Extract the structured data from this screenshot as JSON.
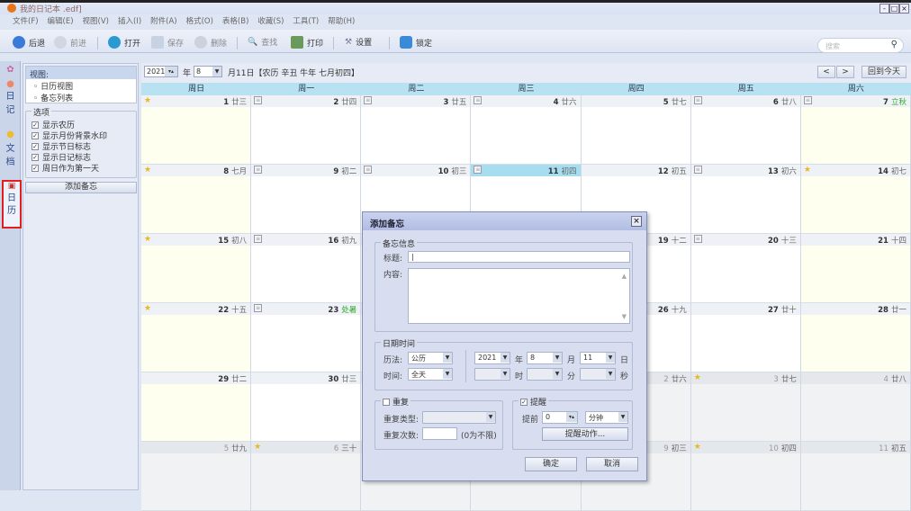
{
  "window": {
    "title": "我的日记本 .edf]",
    "min": "-",
    "max": "□",
    "close": "×"
  },
  "menu": [
    "文件(F)",
    "编辑(E)",
    "视图(V)",
    "插入(I)",
    "附件(A)",
    "格式(O)",
    "表格(B)",
    "收藏(S)",
    "工具(T)",
    "帮助(H)"
  ],
  "toolbar": {
    "back": "后退",
    "forward": "前进",
    "open": "打开",
    "save": "保存",
    "delete": "删除",
    "find": "查找",
    "print": "打印",
    "settings": "设置",
    "lock": "锁定"
  },
  "search": {
    "placeholder": "搜索"
  },
  "vtabs": {
    "diary": "日记",
    "docs": "文档",
    "calendar": "日历"
  },
  "panel": {
    "view_title": "视图:",
    "views": [
      "日历视图",
      "备忘列表"
    ],
    "options_title": "选项",
    "options": [
      "显示农历",
      "显示月份背景水印",
      "显示节日标志",
      "显示日记标志",
      "周日作为第一天"
    ],
    "add_memo": "添加备忘"
  },
  "datebar": {
    "year": "2021",
    "year_label": "年",
    "month": "8",
    "info": "月11日【农历 辛丑 牛年 七月初四】",
    "prev": "<",
    "next": ">",
    "today": "回到今天"
  },
  "weekdays": [
    "周日",
    "周一",
    "周二",
    "周三",
    "周四",
    "周五",
    "周六"
  ],
  "calendar": {
    "weeks": [
      [
        {
          "d": "1",
          "l": "廿三",
          "i": "star"
        },
        {
          "d": "2",
          "l": "廿四",
          "i": "note"
        },
        {
          "d": "3",
          "l": "廿五",
          "i": "note"
        },
        {
          "d": "4",
          "l": "廿六",
          "i": "note"
        },
        {
          "d": "5",
          "l": "廿七",
          "i": ""
        },
        {
          "d": "6",
          "l": "廿八",
          "i": "note"
        },
        {
          "d": "7",
          "l": "立秋",
          "i": "note",
          "t": 1
        }
      ],
      [
        {
          "d": "8",
          "l": "七月",
          "i": "star"
        },
        {
          "d": "9",
          "l": "初二",
          "i": "note"
        },
        {
          "d": "10",
          "l": "初三",
          "i": "note"
        },
        {
          "d": "11",
          "l": "初四",
          "i": "note",
          "today": 1
        },
        {
          "d": "12",
          "l": "初五",
          "i": ""
        },
        {
          "d": "13",
          "l": "初六",
          "i": "note"
        },
        {
          "d": "14",
          "l": "初七",
          "i": "star"
        }
      ],
      [
        {
          "d": "15",
          "l": "初八",
          "i": "star"
        },
        {
          "d": "16",
          "l": "初九",
          "i": "note"
        },
        {
          "d": "",
          "l": "",
          "i": ""
        },
        {
          "d": "",
          "l": "",
          "i": ""
        },
        {
          "d": "19",
          "l": "十二",
          "i": ""
        },
        {
          "d": "20",
          "l": "十三",
          "i": "note"
        },
        {
          "d": "21",
          "l": "十四",
          "i": ""
        }
      ],
      [
        {
          "d": "22",
          "l": "十五",
          "i": "star"
        },
        {
          "d": "23",
          "l": "处暑",
          "i": "note",
          "t": 1
        },
        {
          "d": "",
          "l": "",
          "i": ""
        },
        {
          "d": "",
          "l": "",
          "i": ""
        },
        {
          "d": "26",
          "l": "十九",
          "i": ""
        },
        {
          "d": "27",
          "l": "廿十",
          "i": ""
        },
        {
          "d": "28",
          "l": "廿一",
          "i": ""
        }
      ],
      [
        {
          "d": "29",
          "l": "廿二",
          "i": ""
        },
        {
          "d": "30",
          "l": "廿三",
          "i": ""
        },
        {
          "d": "",
          "l": "",
          "i": ""
        },
        {
          "d": "",
          "l": "",
          "i": "",
          "o": 1
        },
        {
          "d": "2",
          "l": "廿六",
          "i": "",
          "o": 1
        },
        {
          "d": "3",
          "l": "廿七",
          "i": "star",
          "o": 1
        },
        {
          "d": "4",
          "l": "廿八",
          "i": "",
          "o": 1
        }
      ],
      [
        {
          "d": "5",
          "l": "廿九",
          "i": "",
          "o": 1
        },
        {
          "d": "6",
          "l": "三十",
          "i": "star",
          "o": 1
        },
        {
          "d": "",
          "l": "",
          "i": "",
          "o": 1
        },
        {
          "d": "",
          "l": "",
          "i": "",
          "o": 1
        },
        {
          "d": "9",
          "l": "初三",
          "i": "",
          "o": 1
        },
        {
          "d": "10",
          "l": "初四",
          "i": "star",
          "o": 1
        },
        {
          "d": "11",
          "l": "初五",
          "i": "",
          "o": 1
        }
      ]
    ]
  },
  "dialog": {
    "title": "添加备忘",
    "close": "×",
    "info_group": "备忘信息",
    "title_label": "标题:",
    "title_value": "|",
    "content_label": "内容:",
    "datetime_group": "日期时间",
    "calendar_label": "历法:",
    "calendar_value": "公历",
    "time_label": "时间:",
    "time_value": "全天",
    "year": "2021",
    "year_label": "年",
    "month": "8",
    "month_label": "月",
    "day": "11",
    "day_label": "日",
    "hour_label": "时",
    "minute_label": "分",
    "second_label": "秒",
    "repeat_label": "重复",
    "repeat_type_label": "重复类型:",
    "repeat_count_label": "重复次数:",
    "repeat_hint": "(0为不限)",
    "remind_label": "提醒",
    "remind_ahead_label": "提前",
    "remind_ahead_value": "0",
    "remind_unit": "分钟",
    "remind_action": "提醒动作...",
    "ok": "确定",
    "cancel": "取消"
  }
}
